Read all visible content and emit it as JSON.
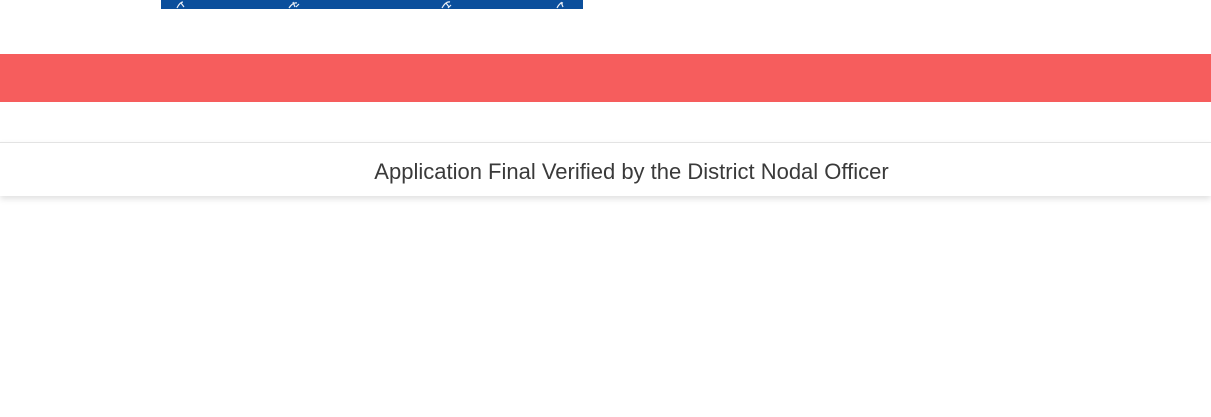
{
  "header": {
    "logo_color": "#0b4f9c",
    "logo_icon": "emblem-banner-logo"
  },
  "nav_bar": {
    "color": "#f65d5d"
  },
  "status": {
    "message": "Application Final Verified by the District Nodal Officer"
  }
}
